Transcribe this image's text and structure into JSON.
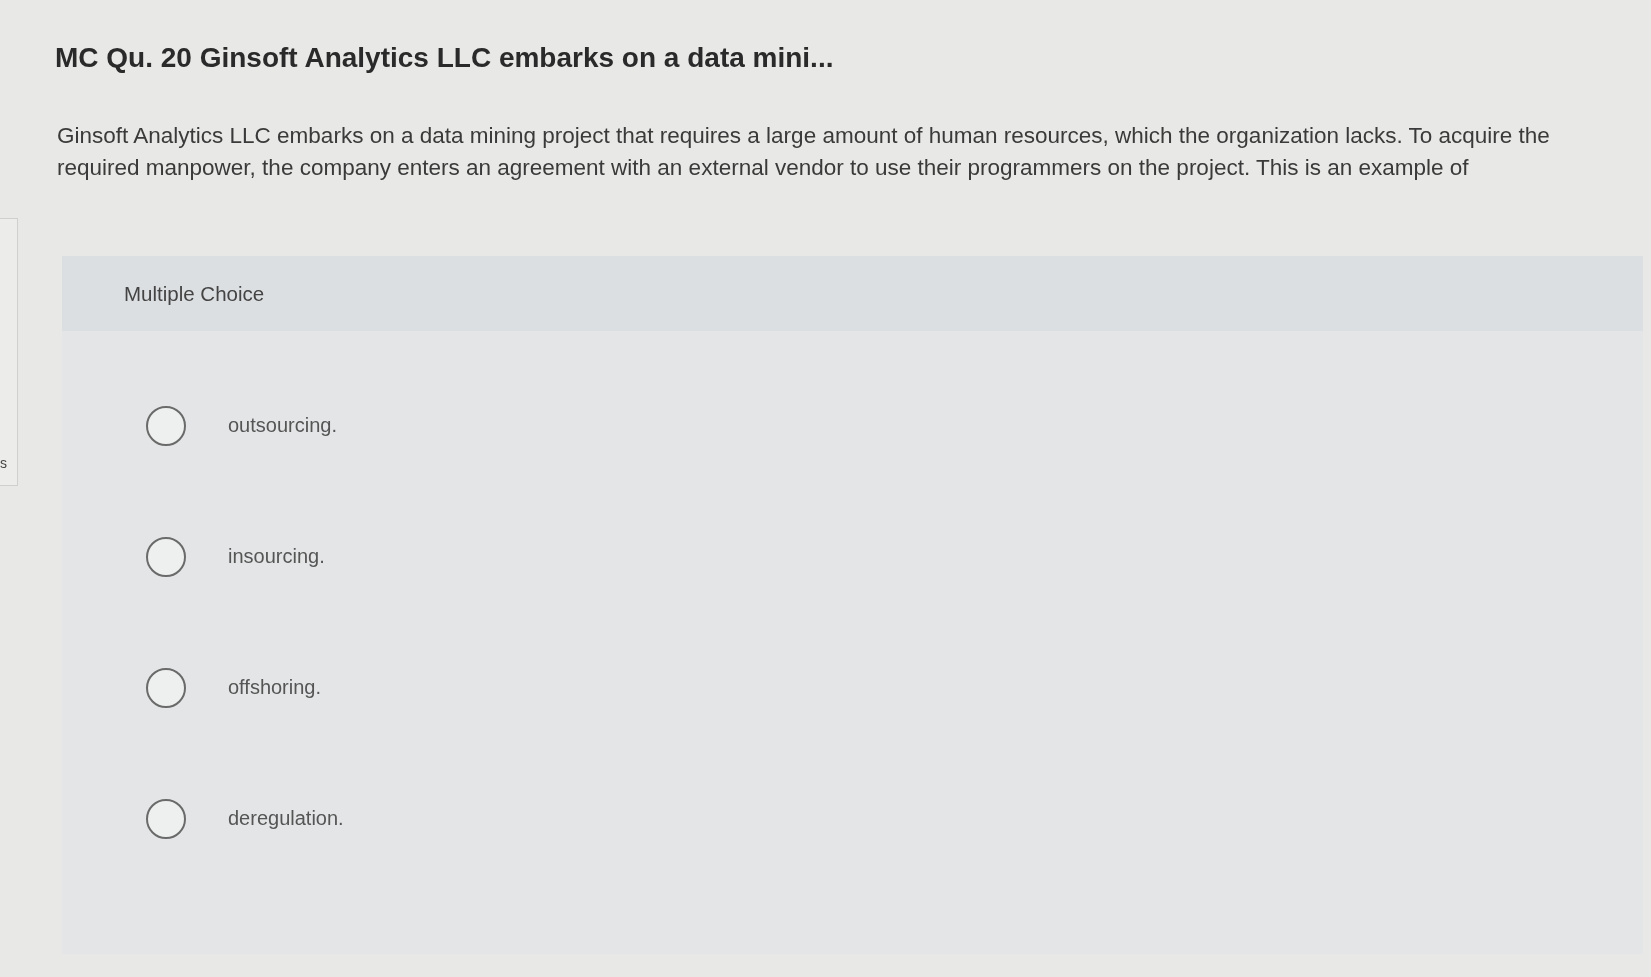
{
  "side_panel": {
    "text": "s"
  },
  "title": "MC Qu. 20 Ginsoft Analytics LLC embarks on a data mini...",
  "question": "Ginsoft Analytics LLC embarks on a data mining project that requires a large amount of human resources, which the organization lacks. To acquire the required manpower, the company enters an agreement with an external vendor to use their programmers on the project. This is an example of",
  "answer_panel": {
    "heading": "Multiple Choice",
    "choices": [
      {
        "label": "outsourcing.",
        "selected": false
      },
      {
        "label": "insourcing.",
        "selected": false
      },
      {
        "label": "offshoring.",
        "selected": false
      },
      {
        "label": "deregulation.",
        "selected": false
      }
    ]
  }
}
